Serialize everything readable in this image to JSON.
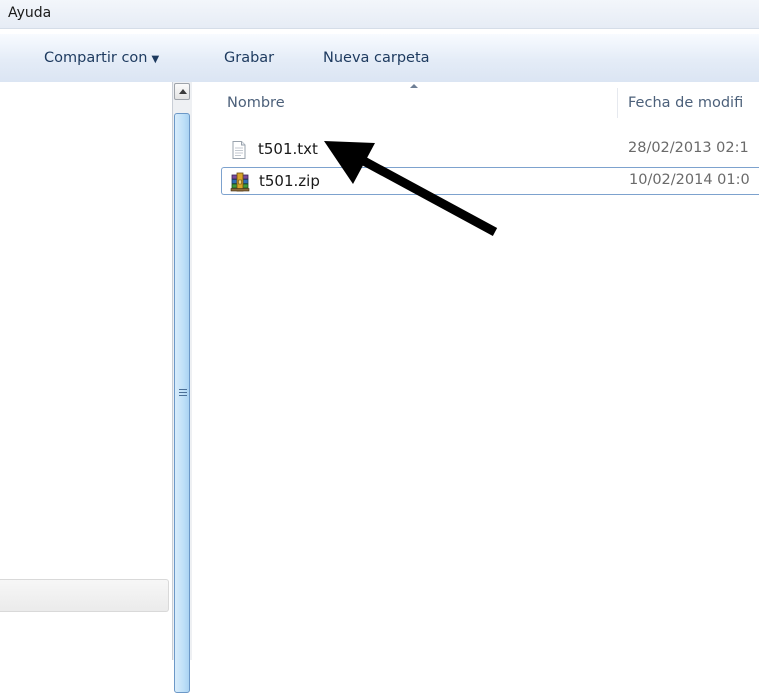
{
  "menubar": {
    "help_label": "Ayuda"
  },
  "toolbar": {
    "share_label": "Compartir con",
    "burn_label": "Grabar",
    "new_folder_label": "Nueva carpeta"
  },
  "columns": {
    "name_header": "Nombre",
    "date_header": "Fecha de modifi"
  },
  "files": [
    {
      "name": "t501.txt",
      "date": "28/02/2013 02:1",
      "icon": "text-file-icon",
      "selected": false
    },
    {
      "name": "t501.zip",
      "date": "10/02/2014 01:0",
      "icon": "winrar-archive-icon",
      "selected": true
    }
  ],
  "colors": {
    "toolbar_text": "#1d3a5f",
    "selection_border": "#7da2ce",
    "annotation_arrow": "#000000"
  }
}
